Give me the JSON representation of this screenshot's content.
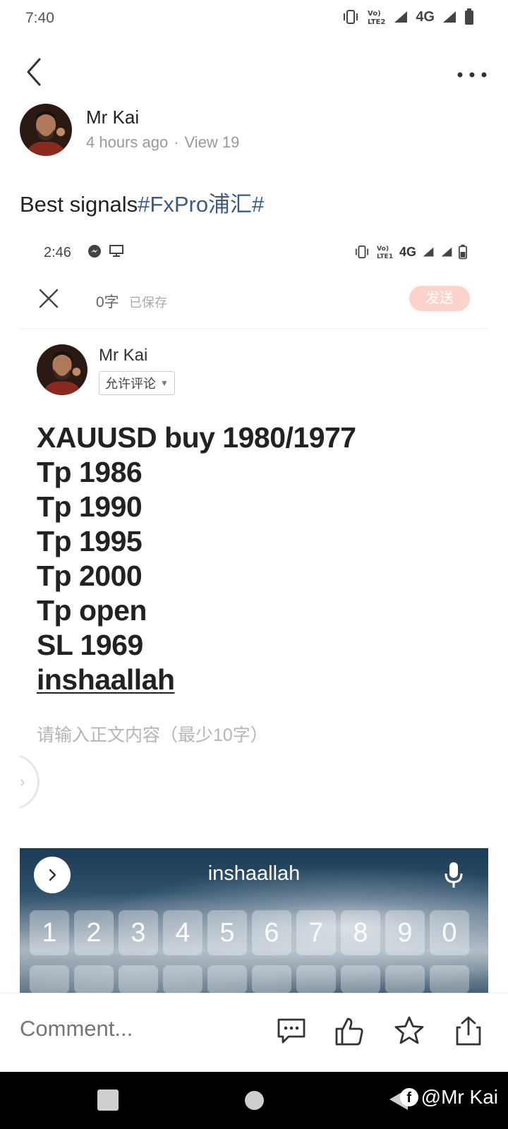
{
  "status_bar": {
    "time": "7:40",
    "network": "4G"
  },
  "post": {
    "author": "Mr Kai",
    "time_ago": "4 hours ago",
    "separator": "·",
    "views": "View 19",
    "text": "Best signals",
    "hashtag": "#FxPro浦汇#"
  },
  "screenshot": {
    "status_time": "2:46",
    "network": "4G",
    "char_count": "0字",
    "saved_label": "已保存",
    "send_label": "发送",
    "author": "Mr Kai",
    "permission": "允许评论",
    "lines": [
      "XAUUSD buy 1980/1977",
      "Tp 1986",
      "Tp 1990",
      "Tp 1995",
      "Tp 2000",
      "Tp open",
      "SL 1969"
    ],
    "last_line": "inshaallah",
    "body_placeholder": "请输入正文内容（最少10字）",
    "keyboard_suggestion": "inshaallah",
    "keyboard_numbers": [
      "1",
      "2",
      "3",
      "4",
      "5",
      "6",
      "7",
      "8",
      "9",
      "0"
    ]
  },
  "bottom_bar": {
    "comment_placeholder": "Comment..."
  },
  "watermark": {
    "logo": "f",
    "text": "@Mr Kai"
  },
  "colors": {
    "hashtag": "#3d5a85",
    "comment_placeholder": "#a7794a",
    "send_button": "#fbd3cc"
  }
}
